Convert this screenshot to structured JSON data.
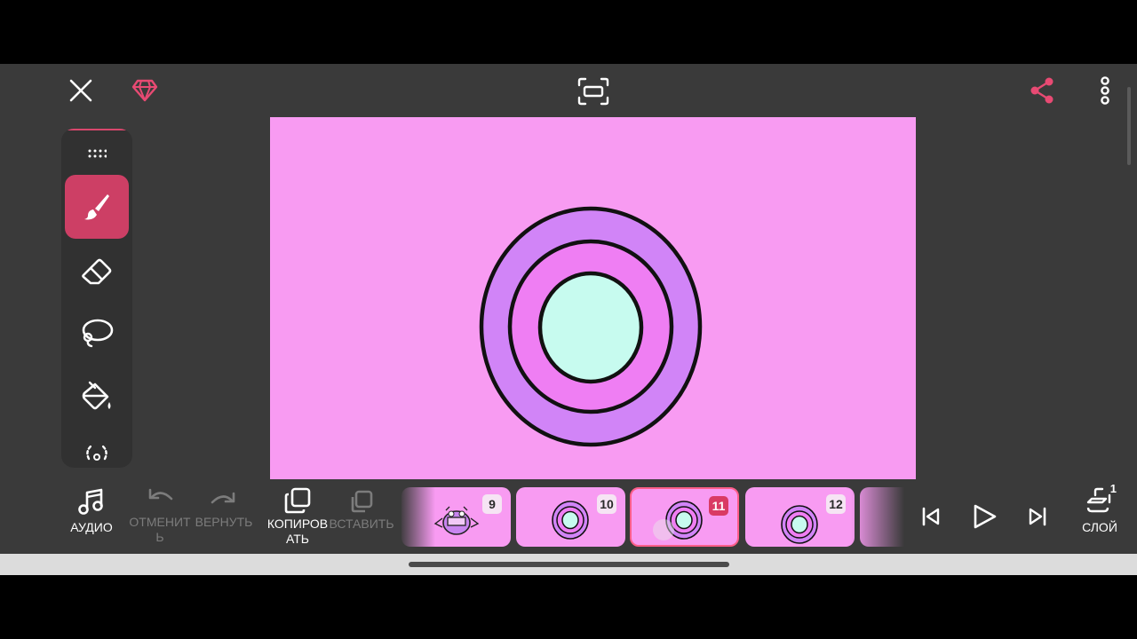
{
  "toolbar": {
    "close_icon": "close-icon",
    "premium_icon": "gem-icon",
    "fullscreen_icon": "fit-screen-icon",
    "share_icon": "share-icon",
    "more_icon": "more-vertical-icon"
  },
  "tools": [
    "drag-handle-icon",
    "brush-icon",
    "eraser-icon",
    "lasso-icon",
    "fill-bucket-icon",
    "blur-icon"
  ],
  "actions": {
    "audio": "АУДИО",
    "undo_line1": "ОТМЕНИТ",
    "undo_line2": "Ь",
    "redo": "ВЕРНУТЬ",
    "copy_line1": "КОПИРОВ",
    "copy_line2": "АТЬ",
    "paste": "ВСТАВИТЬ",
    "layer": "СЛОЙ",
    "layer_count": "1"
  },
  "frames": [
    {
      "number": "9",
      "active": false
    },
    {
      "number": "10",
      "active": false
    },
    {
      "number": "11",
      "active": true
    },
    {
      "number": "12",
      "active": false
    }
  ],
  "playback": {
    "first_icon": "skip-to-start-icon",
    "play_icon": "play-icon",
    "last_icon": "skip-to-end-icon"
  },
  "colors": {
    "accent": "#d93a64",
    "canvas_bg": "#f89bf2",
    "ring_outer": "#d184f7",
    "ring_middle": "#ef7ef3",
    "core": "#c7fbef"
  }
}
